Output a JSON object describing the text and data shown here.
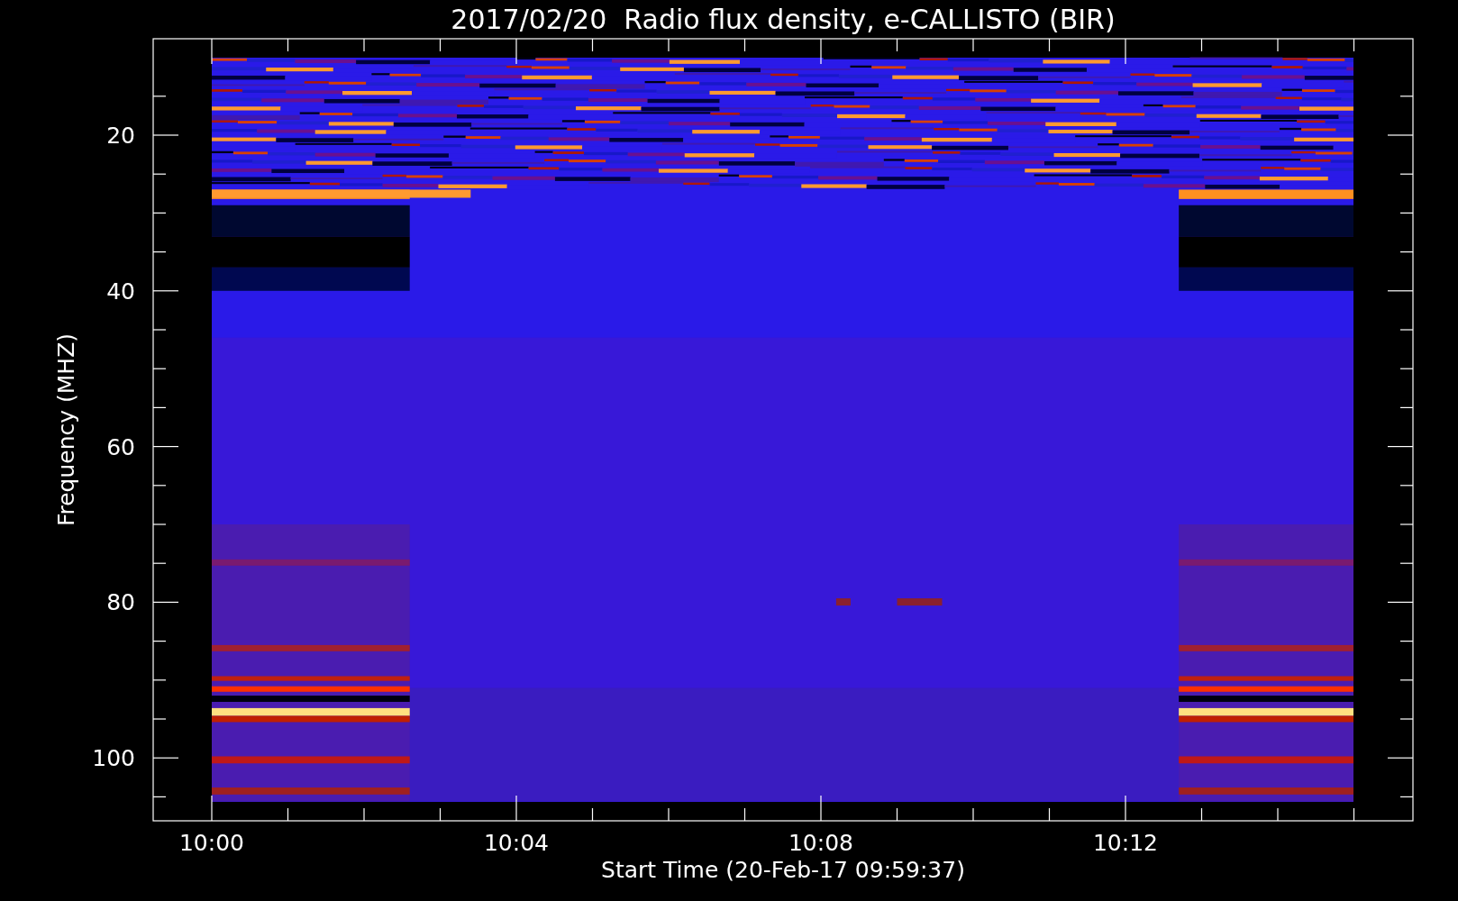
{
  "title": "2017/02/20  Radio flux density, e-CALLISTO (BIR)",
  "ylabel": "Frequency (MHZ)",
  "xlabel": "Start Time (20-Feb-17 09:59:37)",
  "yticks": [
    "20",
    "40",
    "60",
    "80",
    "100"
  ],
  "xticks": [
    "10:00",
    "10:04",
    "10:08",
    "10:12"
  ]
}
